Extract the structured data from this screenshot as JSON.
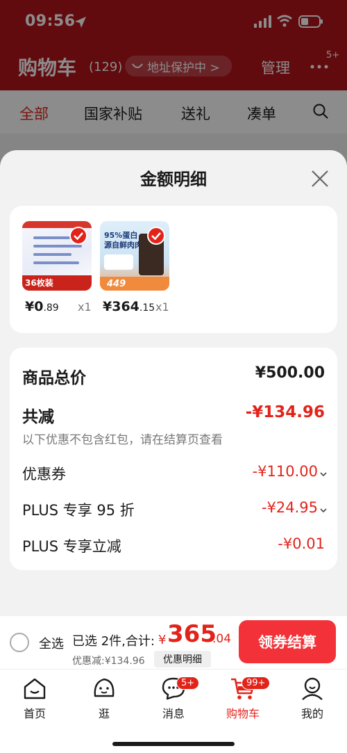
{
  "status_bar": {
    "time": "09:56"
  },
  "header": {
    "title": "购物车",
    "count": "(129)",
    "address_pill": "地址保护中 >",
    "manage": "管理",
    "more_badge": "5+"
  },
  "tabs": [
    {
      "label": "全部",
      "active": true
    },
    {
      "label": "国家补贴",
      "active": false
    },
    {
      "label": "送礼",
      "active": false
    },
    {
      "label": "凑单",
      "active": false
    }
  ],
  "sheet": {
    "title": "金额明细",
    "products": [
      {
        "price_int": "¥0",
        "price_dec": ".89",
        "qty": "x1",
        "thumb_label": "36枚装"
      },
      {
        "price_int": "¥364",
        "price_dec": ".15",
        "qty": "x1",
        "thumb_label": "449",
        "thumb_text": "95%蛋白\n源自鲜肉肉"
      }
    ],
    "detail": {
      "goods_total_label": "商品总价",
      "goods_total_value": "¥500.00",
      "total_reduce_label": "共减",
      "total_reduce_value": "-¥134.96",
      "note": "以下优惠不包含红包，请在结算页查看",
      "coupon_label": "优惠券",
      "coupon_value": "-¥110.00",
      "plus95_label": "PLUS 专享 95 折",
      "plus95_value": "-¥24.95",
      "plus_reduce_label": "PLUS 专享立减",
      "plus_reduce_value": "-¥0.01"
    }
  },
  "checkout": {
    "select_all": "全选",
    "selected": "已选 2件,合计:",
    "currency": "¥",
    "total_int": "365",
    "total_dec": ".04",
    "discount": "优惠减:¥134.96",
    "detail_toggle": "优惠明细",
    "button": "领券结算"
  },
  "tab_bar": [
    {
      "label": "首页",
      "icon": "home-icon"
    },
    {
      "label": "逛",
      "icon": "explore-icon"
    },
    {
      "label": "消息",
      "icon": "message-icon",
      "badge": "5+"
    },
    {
      "label": "购物车",
      "icon": "cart-icon",
      "badge": "99+",
      "active": true
    },
    {
      "label": "我的",
      "icon": "profile-icon"
    }
  ],
  "colors": {
    "accent": "#e2231a",
    "header_red": "#b3151c",
    "checkout_button": "#f23238"
  }
}
